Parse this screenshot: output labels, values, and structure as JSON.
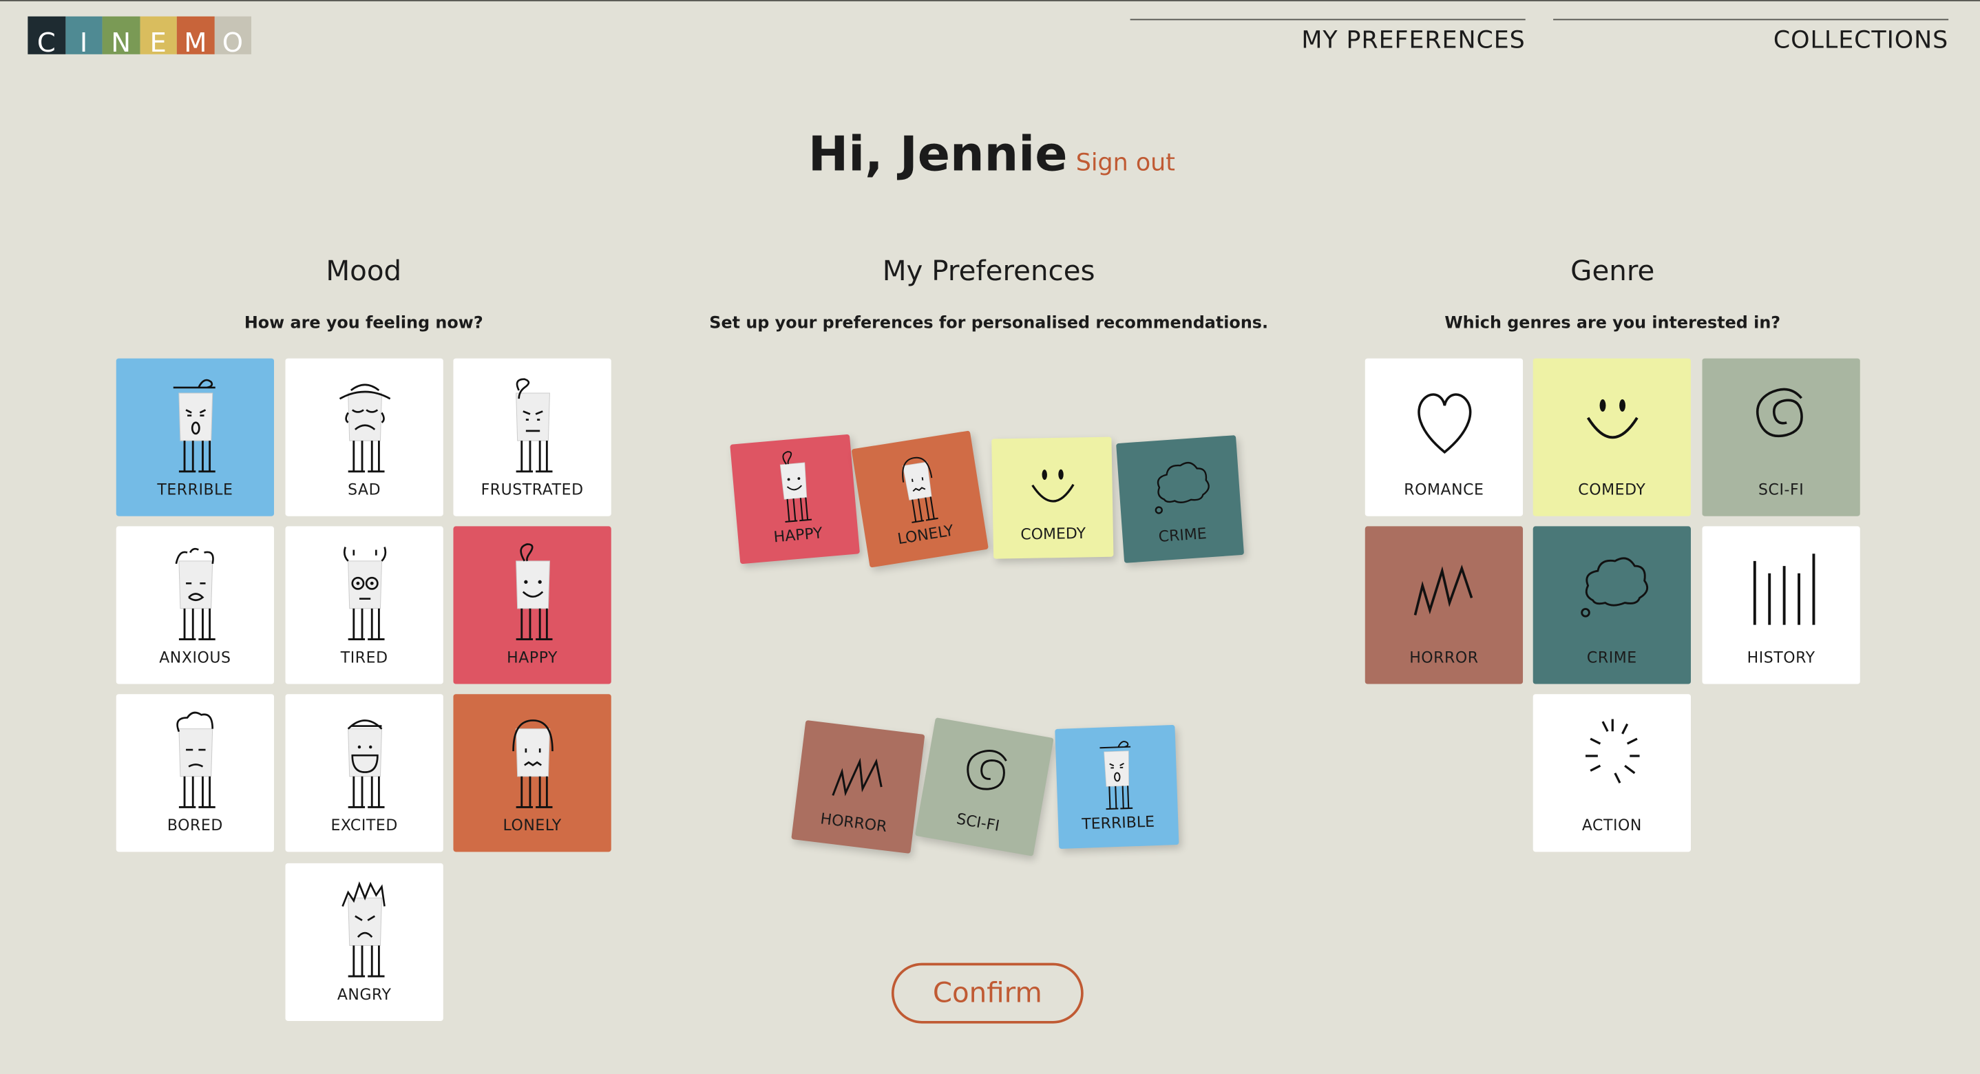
{
  "logo": {
    "letters": [
      "C",
      "I",
      "N",
      "E",
      "M",
      "O"
    ],
    "colors": [
      "#1e2b31",
      "#4f8a93",
      "#7a9a55",
      "#d9bd5e",
      "#c8643a",
      "#c7c4b6"
    ]
  },
  "nav": {
    "preferences": "MY PREFERENCES",
    "collections": "COLLECTIONS"
  },
  "greeting": {
    "title": "Hi, Jennie",
    "sign_out": "Sign out"
  },
  "mood": {
    "title": "Mood",
    "subtitle": "How are you feeling now?",
    "tiles": [
      {
        "label": "TERRIBLE",
        "icon": "terrible-face-icon",
        "color": "#74bbe6"
      },
      {
        "label": "SAD",
        "icon": "sad-face-icon",
        "color": "#ffffff"
      },
      {
        "label": "FRUSTRATED",
        "icon": "frustrated-face-icon",
        "color": "#ffffff"
      },
      {
        "label": "ANXIOUS",
        "icon": "anxious-face-icon",
        "color": "#ffffff"
      },
      {
        "label": "TIRED",
        "icon": "tired-face-icon",
        "color": "#ffffff"
      },
      {
        "label": "HAPPY",
        "icon": "happy-face-icon",
        "color": "#de5563"
      },
      {
        "label": "BORED",
        "icon": "bored-face-icon",
        "color": "#ffffff"
      },
      {
        "label": "EXCITED",
        "icon": "excited-face-icon",
        "color": "#ffffff"
      },
      {
        "label": "LONELY",
        "icon": "lonely-face-icon",
        "color": "#d06c46"
      },
      {
        "label": "ANGRY",
        "icon": "angry-face-icon",
        "color": "#ffffff"
      }
    ]
  },
  "preferences": {
    "title": "My Preferences",
    "subtitle": "Set up your preferences for personalised recommendations.",
    "selected": [
      {
        "label": "HAPPY",
        "icon": "happy-face-icon",
        "color": "#de5563"
      },
      {
        "label": "LONELY",
        "icon": "lonely-face-icon",
        "color": "#d06c46"
      },
      {
        "label": "COMEDY",
        "icon": "smiley-icon",
        "color": "#eef2a5"
      },
      {
        "label": "CRIME",
        "icon": "thought-cloud-icon",
        "color": "#4a7878"
      },
      {
        "label": "HORROR",
        "icon": "zigzag-icon",
        "color": "#ab6f60"
      },
      {
        "label": "SCI-FI",
        "icon": "spiral-icon",
        "color": "#a9b6a1"
      },
      {
        "label": "TERRIBLE",
        "icon": "terrible-face-icon",
        "color": "#74bbe6"
      }
    ]
  },
  "genre": {
    "title": "Genre",
    "subtitle": "Which genres are you interested in?",
    "tiles": [
      {
        "label": "ROMANCE",
        "icon": "heart-icon",
        "color": "#ffffff"
      },
      {
        "label": "COMEDY",
        "icon": "smiley-icon",
        "color": "#eef2a5"
      },
      {
        "label": "SCI-FI",
        "icon": "spiral-icon",
        "color": "#a9b6a1"
      },
      {
        "label": "HORROR",
        "icon": "zigzag-icon",
        "color": "#ab6f60"
      },
      {
        "label": "CRIME",
        "icon": "thought-cloud-icon",
        "color": "#4a7878"
      },
      {
        "label": "HISTORY",
        "icon": "vertical-lines-icon",
        "color": "#ffffff"
      },
      {
        "label": "ACTION",
        "icon": "burst-icon",
        "color": "#ffffff"
      }
    ]
  },
  "confirm_label": "Confirm"
}
